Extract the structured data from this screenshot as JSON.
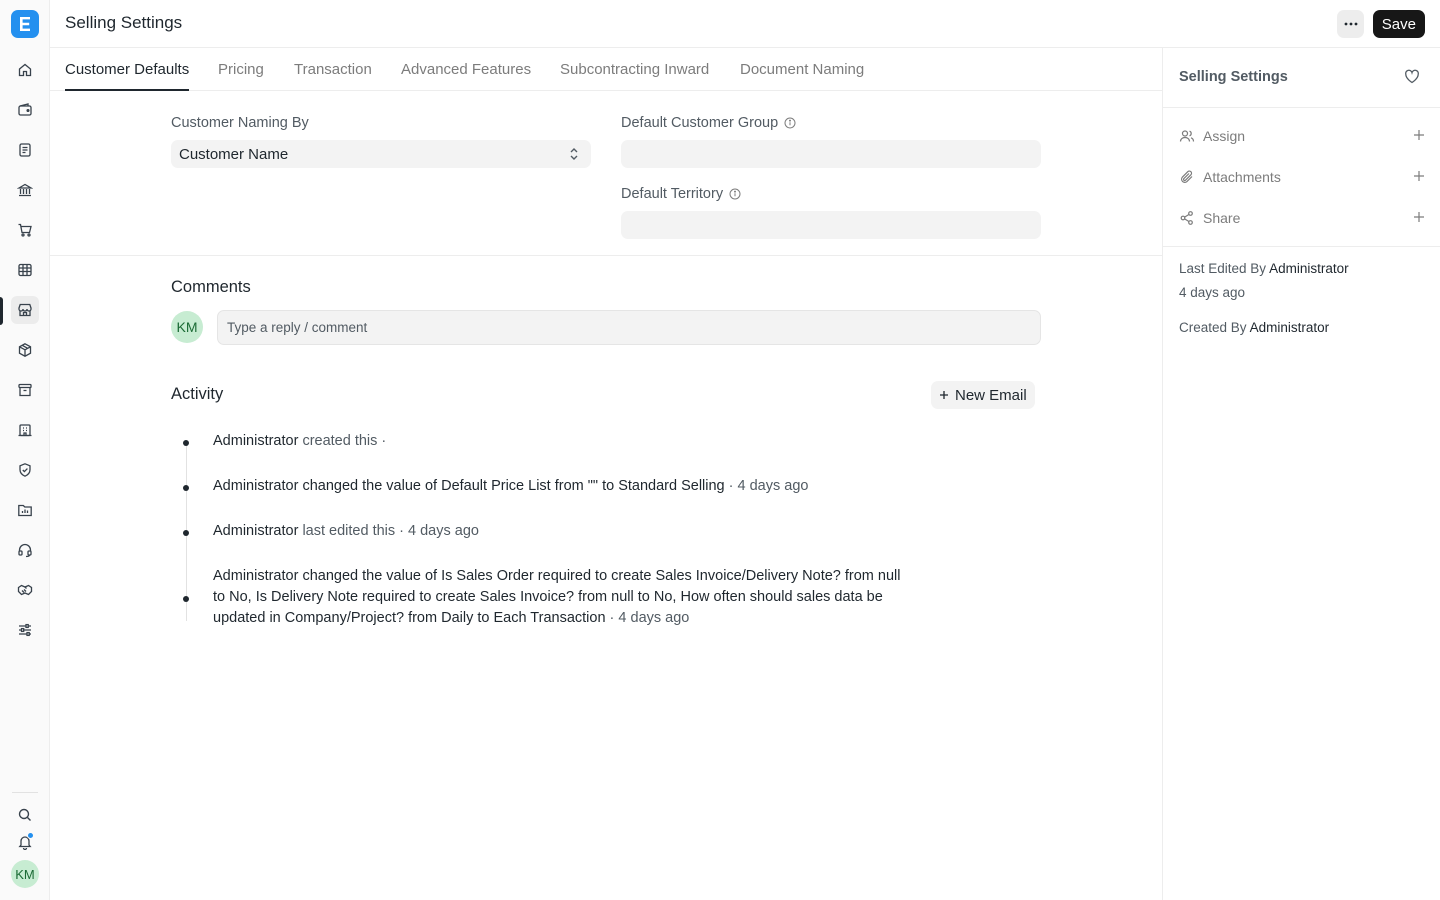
{
  "app": {
    "logo_letter": "E",
    "user_initials": "KM"
  },
  "rail": {
    "icons": [
      "home-icon",
      "wallet-icon",
      "document-icon",
      "bank-icon",
      "cart-icon",
      "table-icon",
      "store-icon",
      "package-icon",
      "archive-icon",
      "building-icon",
      "shield-icon",
      "folder-chart-icon",
      "headset-icon",
      "handshake-icon",
      "sliders-icon"
    ],
    "active_index": 6,
    "bottom_icons": [
      "search-icon",
      "bell-icon"
    ]
  },
  "header": {
    "title": "Selling Settings",
    "save_label": "Save"
  },
  "tabs": [
    {
      "label": "Customer Defaults",
      "active": true
    },
    {
      "label": "Pricing",
      "active": false
    },
    {
      "label": "Transaction",
      "active": false
    },
    {
      "label": "Advanced Features",
      "active": false
    },
    {
      "label": "Subcontracting Inward",
      "active": false
    },
    {
      "label": "Document Naming",
      "active": false
    }
  ],
  "form": {
    "customer_naming_by": {
      "label": "Customer Naming By",
      "value": "Customer Name"
    },
    "default_customer_group": {
      "label": "Default Customer Group",
      "value": ""
    },
    "default_territory": {
      "label": "Default Territory",
      "value": ""
    }
  },
  "comments": {
    "title": "Comments",
    "avatar_initials": "KM",
    "placeholder": "Type a reply / comment"
  },
  "activity": {
    "title": "Activity",
    "new_email_label": "New Email",
    "items": [
      {
        "parts": [
          {
            "text": "Administrator",
            "strong": true
          },
          {
            "text": " created this ·",
            "strong": false
          }
        ]
      },
      {
        "parts": [
          {
            "text": "Administrator changed the value of Default Price List from \"\" to ",
            "strong": true
          },
          {
            "text": "Standard Selling",
            "strong": true
          },
          {
            "text": " · 4 days ago",
            "strong": false
          }
        ]
      },
      {
        "parts": [
          {
            "text": "Administrator",
            "strong": true
          },
          {
            "text": " last edited this · 4 days ago",
            "strong": false
          }
        ]
      },
      {
        "parts": [
          {
            "text": "Administrator changed the value of Is Sales Order required to create Sales Invoice/Delivery Note? from ",
            "strong": true
          },
          {
            "text": "null",
            "strong": true
          },
          {
            "text": " to ",
            "strong": true
          },
          {
            "text": "No",
            "strong": true
          },
          {
            "text": ", Is Delivery Note required to create Sales Invoice? from ",
            "strong": true
          },
          {
            "text": "null",
            "strong": true
          },
          {
            "text": " to ",
            "strong": true
          },
          {
            "text": "No",
            "strong": true
          },
          {
            "text": ", How often should sales data be updated in Company/Project? from ",
            "strong": true
          },
          {
            "text": "Daily",
            "strong": true
          },
          {
            "text": " to ",
            "strong": true
          },
          {
            "text": "Each Transaction",
            "strong": true
          },
          {
            "text": " · 4 days ago",
            "strong": false
          }
        ]
      }
    ]
  },
  "sidebar": {
    "title": "Selling Settings",
    "assign_label": "Assign",
    "attachments_label": "Attachments",
    "share_label": "Share",
    "last_edited_prefix": "Last Edited By",
    "last_edited_by": "Administrator",
    "last_edited_time": "4 days ago",
    "created_prefix": "Created By",
    "created_by": "Administrator"
  }
}
